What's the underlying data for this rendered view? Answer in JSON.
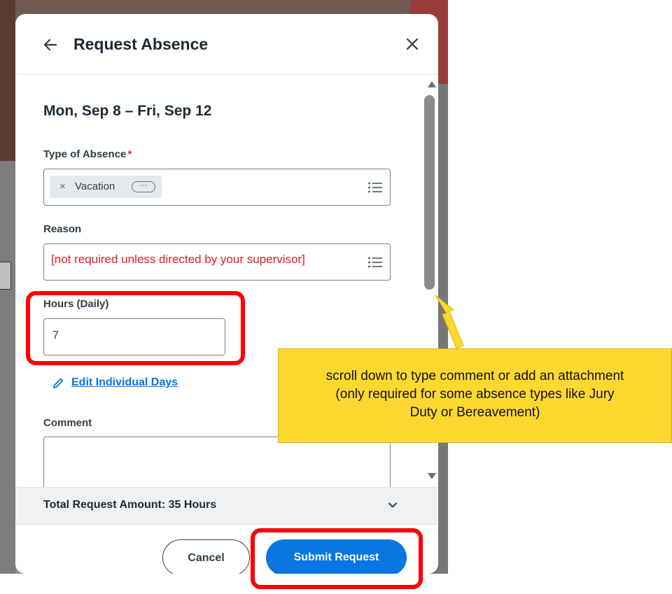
{
  "dialog": {
    "title": "Request Absence",
    "date_range": "Mon, Sep 8 – Fri, Sep 12"
  },
  "fields": {
    "type_of_absence": {
      "label": "Type of Absence",
      "required_marker": "*",
      "selected_value": "Vacation",
      "remove_glyph": "×",
      "more_glyph": "···"
    },
    "reason": {
      "label": "Reason",
      "placeholder": "[not required unless directed by your supervisor]"
    },
    "hours_daily": {
      "label": "Hours (Daily)",
      "value": "7"
    },
    "comment": {
      "label": "Comment",
      "value": ""
    }
  },
  "links": {
    "edit_individual_days": "Edit Individual Days"
  },
  "summary": {
    "total_label": "Total Request Amount: 35 Hours"
  },
  "buttons": {
    "cancel": "Cancel",
    "submit": "Submit Request"
  },
  "annotation": {
    "callout_lines": [
      "scroll down to type comment or add an attachment",
      "(only required for some absence types like Jury",
      "Duty or Bereavement)"
    ]
  },
  "icons": {
    "back": "arrow-left-icon",
    "close": "close-icon",
    "list": "list-icon",
    "edit": "pencil-icon",
    "expand": "chevron-down-icon"
  },
  "colors": {
    "primary": "#0875e1",
    "required": "#d7262e",
    "placeholder_red": "#e11d26",
    "highlight_red": "#ff0000",
    "callout_yellow": "#fdd92f"
  }
}
